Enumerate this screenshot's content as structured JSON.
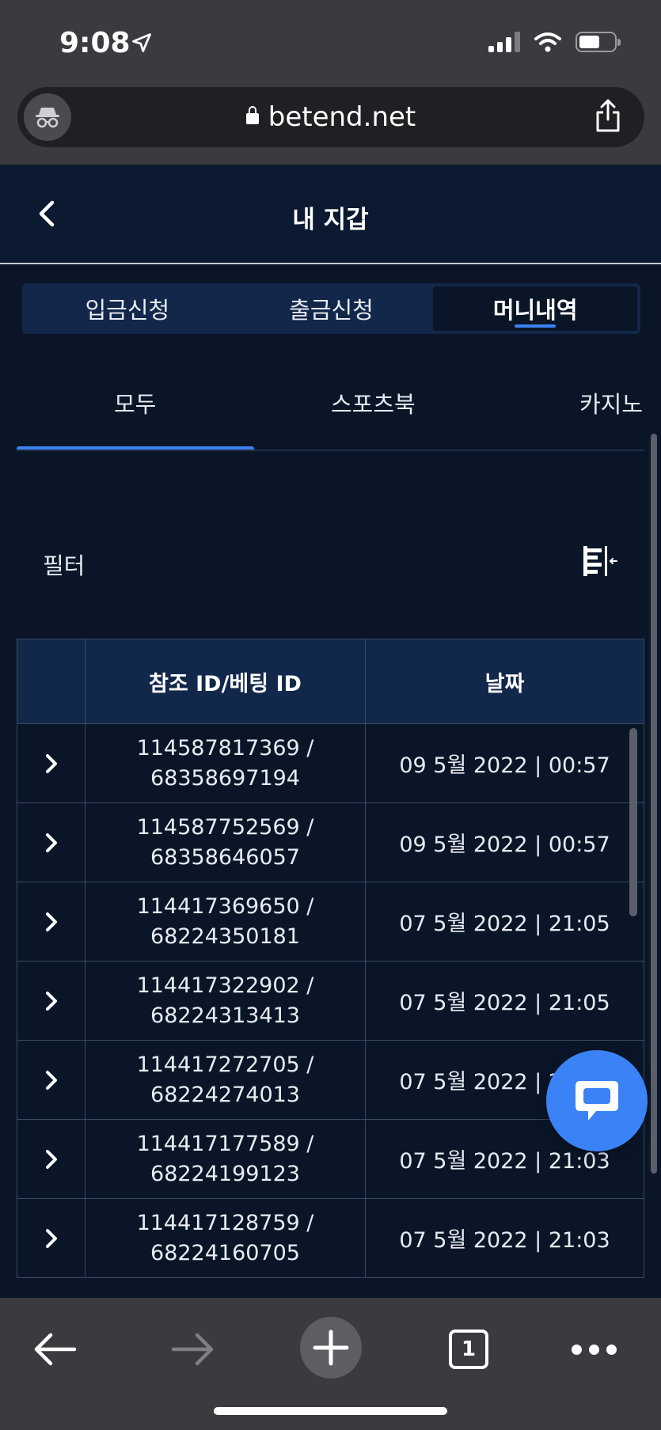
{
  "status_bar": {
    "time": "9:08"
  },
  "browser": {
    "url": "betend.net"
  },
  "header": {
    "title": "내 지갑"
  },
  "wallet_tabs": [
    {
      "label": "입금신청",
      "active": false
    },
    {
      "label": "출금신청",
      "active": false
    },
    {
      "label": "머니내역",
      "active": true
    }
  ],
  "category_tabs": [
    {
      "label": "모두",
      "active": true
    },
    {
      "label": "스포츠북",
      "active": false
    },
    {
      "label": "카지노",
      "active": false
    }
  ],
  "filter": {
    "label": "필터"
  },
  "table": {
    "headers": [
      "",
      "참조 ID/베팅 ID",
      "날짜"
    ],
    "rows": [
      {
        "ref": "114587817369 /",
        "bet": "68358697194",
        "date": "09 5월 2022 | 00:57"
      },
      {
        "ref": "114587752569 /",
        "bet": "68358646057",
        "date": "09 5월 2022 | 00:57"
      },
      {
        "ref": "114417369650 /",
        "bet": "68224350181",
        "date": "07 5월 2022 | 21:05"
      },
      {
        "ref": "114417322902 /",
        "bet": "68224313413",
        "date": "07 5월 2022 | 21:05"
      },
      {
        "ref": "114417272705 /",
        "bet": "68224274013",
        "date": "07 5월 2022 | 21:04"
      },
      {
        "ref": "114417177589 /",
        "bet": "68224199123",
        "date": "07 5월 2022 | 21:03"
      },
      {
        "ref": "114417128759 /",
        "bet": "68224160705",
        "date": "07 5월 2022 | 21:03"
      }
    ]
  },
  "toolbar": {
    "tab_count": "1"
  },
  "colors": {
    "accent": "#3b82f6",
    "background": "#0a1628",
    "table_header": "#12284a"
  }
}
